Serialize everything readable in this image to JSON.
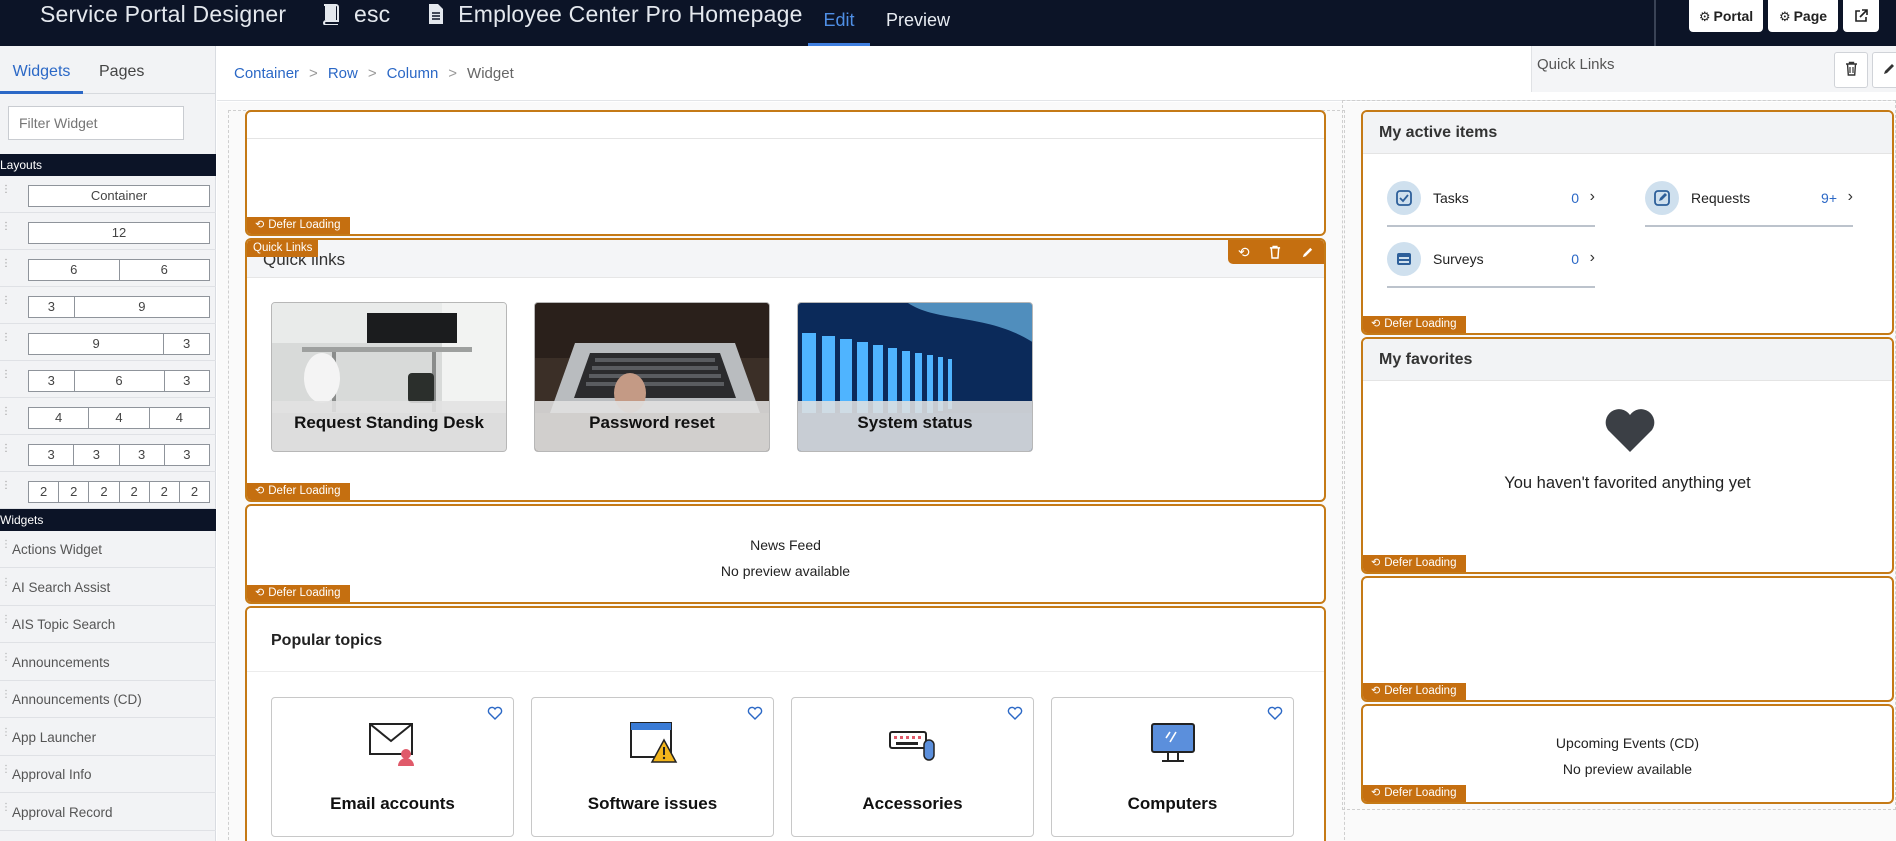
{
  "topbar": {
    "app_title": "Service Portal Designer",
    "portal_name": "esc",
    "page_name": "Employee Center Pro Homepage",
    "tab_edit": "Edit",
    "tab_preview": "Preview",
    "btn_portal": "Portal",
    "btn_page": "Page"
  },
  "left_panel": {
    "tab_widgets": "Widgets",
    "tab_pages": "Pages",
    "filter_placeholder": "Filter Widget",
    "layouts_header": "Layouts",
    "widgets_header": "Widgets",
    "layouts": [
      [
        "Container"
      ],
      [
        "12"
      ],
      [
        "6",
        "6"
      ],
      [
        "3",
        "9"
      ],
      [
        "9",
        "3"
      ],
      [
        "3",
        "6",
        "3"
      ],
      [
        "4",
        "4",
        "4"
      ],
      [
        "3",
        "3",
        "3",
        "3"
      ],
      [
        "2",
        "2",
        "2",
        "2",
        "2",
        "2"
      ]
    ],
    "widgets": [
      "Actions Widget",
      "AI Search Assist",
      "AIS Topic Search",
      "Announcements",
      "Announcements (CD)",
      "App Launcher",
      "Approval Info",
      "Approval Record"
    ]
  },
  "breadcrumb": {
    "items": [
      "Container",
      "Row",
      "Column"
    ],
    "current": "Widget",
    "separator": ">"
  },
  "selected_widget_panel": {
    "label": "Quick Links"
  },
  "defer_label": "Defer Loading",
  "quick_links": {
    "tag": "Quick Links",
    "title": "Quick links",
    "tiles": [
      "Request Standing Desk",
      "Password reset",
      "System status"
    ]
  },
  "news_feed": {
    "title": "News Feed",
    "message": "No preview available"
  },
  "popular_topics": {
    "title": "Popular topics",
    "cards": [
      "Email accounts",
      "Software issues",
      "Accessories",
      "Computers"
    ]
  },
  "active_items": {
    "title": "My active items",
    "items": [
      {
        "name": "Tasks",
        "count": "0"
      },
      {
        "name": "Requests",
        "count": "9+"
      },
      {
        "name": "Surveys",
        "count": "0"
      }
    ]
  },
  "favorites": {
    "title": "My favorites",
    "empty_message": "You haven't favorited anything yet"
  },
  "upcoming_events": {
    "title": "Upcoming Events (CD)",
    "message": "No preview available"
  },
  "colors": {
    "topbar_bg": "#0c1427",
    "accent_blue": "#2b68c6",
    "widget_border_orange": "#c57a16",
    "defer_tag_orange": "#c56f10"
  }
}
